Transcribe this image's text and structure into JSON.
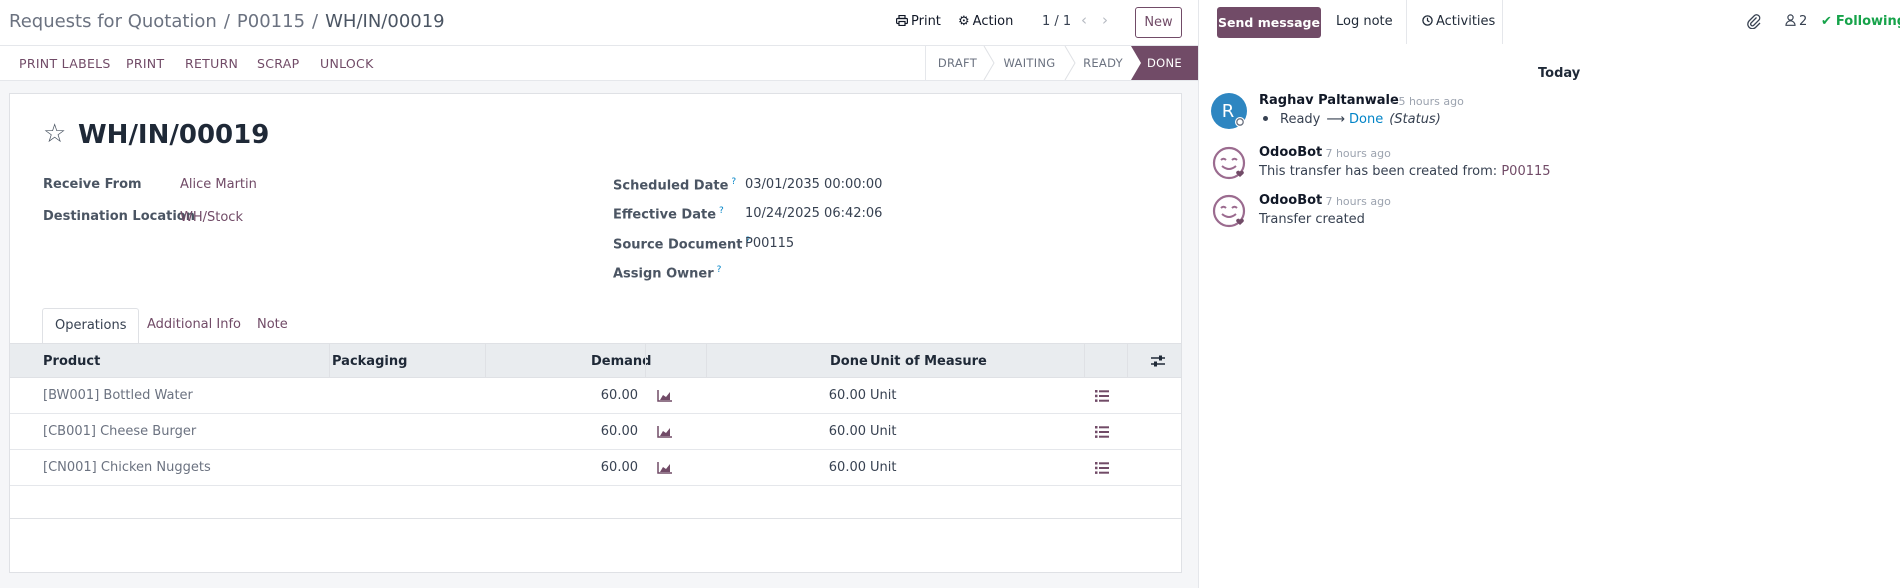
{
  "breadcrumb": {
    "parent": "Requests for Quotation",
    "middle": "P00115",
    "current": "WH/IN/00019"
  },
  "toolbar": {
    "print_label": "Print",
    "action_label": "Action",
    "pager": "1 / 1",
    "new_label": "New"
  },
  "actions": {
    "print_labels": "PRINT LABELS",
    "print": "PRINT",
    "return": "RETURN",
    "scrap": "SCRAP",
    "unlock": "UNLOCK"
  },
  "statusbar": {
    "stages": [
      "DRAFT",
      "WAITING",
      "READY",
      "DONE"
    ],
    "active": "DONE",
    "active_color": "#714b67"
  },
  "record": {
    "title": "WH/IN/00019",
    "receive_from_label": "Receive From",
    "receive_from": "Alice Martin",
    "destination_label": "Destination Location",
    "destination": "WH/Stock",
    "scheduled_label": "Scheduled Date",
    "scheduled": "03/01/2035 00:00:00",
    "effective_label": "Effective Date",
    "effective": "10/24/2025 06:42:06",
    "source_label": "Source Document",
    "source": "P00115",
    "owner_label": "Assign Owner",
    "help_mark": "?"
  },
  "tabs": [
    "Operations",
    "Additional Info",
    "Note"
  ],
  "table": {
    "headers": {
      "product": "Product",
      "packaging": "Packaging",
      "demand": "Demand",
      "done": "Done",
      "uom": "Unit of Measure"
    },
    "rows": [
      {
        "product": "[BW001] Bottled Water",
        "demand": "60.00",
        "done": "60.00",
        "uom": "Unit"
      },
      {
        "product": "[CB001] Cheese Burger",
        "demand": "60.00",
        "done": "60.00",
        "uom": "Unit"
      },
      {
        "product": "[CN001] Chicken Nuggets",
        "demand": "60.00",
        "done": "60.00",
        "uom": "Unit"
      }
    ]
  },
  "chatter": {
    "send_message": "Send message",
    "log_note": "Log note",
    "activities": "Activities",
    "followers_count": "2",
    "following": "Following",
    "date_separator": "Today",
    "messages": [
      {
        "author": "Raghav Paltanwale",
        "ago": "- 5 hours ago",
        "from_status": "Ready",
        "to_status": "Done",
        "field": "(Status)"
      },
      {
        "author": "OdooBot",
        "ago": "- 7 hours ago",
        "text": "This transfer has been created from:",
        "link": "P00115"
      },
      {
        "author": "OdooBot",
        "ago": "- 7 hours ago",
        "text": "Transfer created"
      }
    ]
  },
  "colors": {
    "brand": "#714b67",
    "link_blue": "#0284c7",
    "following_green": "#16a34a"
  }
}
